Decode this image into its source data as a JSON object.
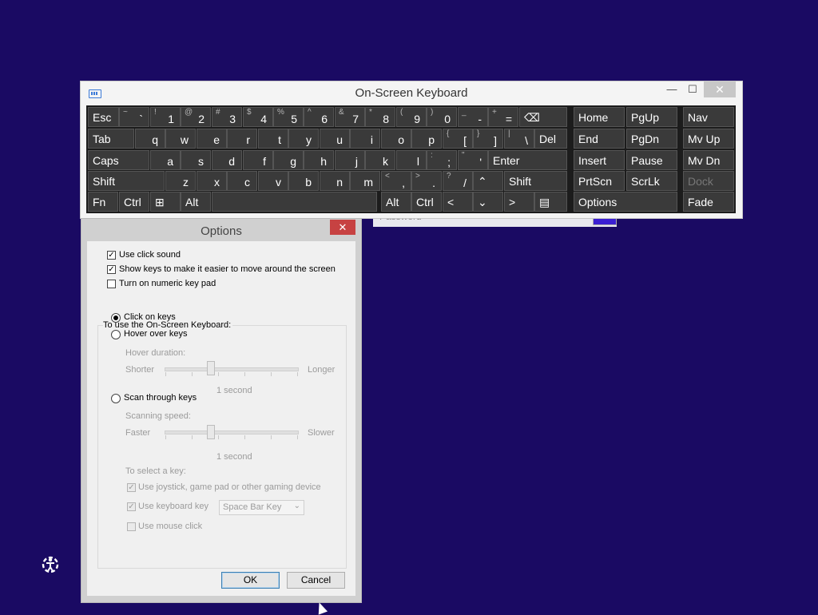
{
  "login": {
    "password_placeholder": "Password"
  },
  "osk": {
    "title": "On-Screen Keyboard",
    "minimize": "—",
    "maximize": "☐",
    "close": "✕",
    "keys": [
      {
        "id": "esc",
        "label": "Esc"
      },
      {
        "id": "tilde",
        "shift": "~",
        "label": "`"
      },
      {
        "id": "k1",
        "shift": "!",
        "label": "1"
      },
      {
        "id": "k2",
        "shift": "@",
        "label": "2"
      },
      {
        "id": "k3",
        "shift": "#",
        "label": "3"
      },
      {
        "id": "k4",
        "shift": "$",
        "label": "4"
      },
      {
        "id": "k5",
        "shift": "%",
        "label": "5"
      },
      {
        "id": "k6",
        "shift": "^",
        "label": "6"
      },
      {
        "id": "k7",
        "shift": "&",
        "label": "7"
      },
      {
        "id": "k8",
        "shift": "*",
        "label": "8"
      },
      {
        "id": "k9",
        "shift": "(",
        "label": "9"
      },
      {
        "id": "k0",
        "shift": ")",
        "label": "0"
      },
      {
        "id": "minus",
        "shift": "_",
        "label": "-"
      },
      {
        "id": "equals",
        "shift": "+",
        "label": "="
      },
      {
        "id": "backspace",
        "label": "⌫"
      },
      {
        "id": "home",
        "label": "Home"
      },
      {
        "id": "pgup",
        "label": "PgUp"
      },
      {
        "id": "nav",
        "label": "Nav"
      },
      {
        "id": "tab",
        "label": "Tab"
      },
      {
        "id": "q",
        "label": "q"
      },
      {
        "id": "w",
        "label": "w"
      },
      {
        "id": "e",
        "label": "e"
      },
      {
        "id": "r",
        "label": "r"
      },
      {
        "id": "t",
        "label": "t"
      },
      {
        "id": "y",
        "label": "y"
      },
      {
        "id": "u",
        "label": "u"
      },
      {
        "id": "i",
        "label": "i"
      },
      {
        "id": "o",
        "label": "o"
      },
      {
        "id": "p",
        "label": "p"
      },
      {
        "id": "lbracket",
        "shift": "{",
        "label": "["
      },
      {
        "id": "rbracket",
        "shift": "}",
        "label": "]"
      },
      {
        "id": "backslash",
        "shift": "|",
        "label": "\\"
      },
      {
        "id": "del",
        "label": "Del"
      },
      {
        "id": "end",
        "label": "End"
      },
      {
        "id": "pgdn",
        "label": "PgDn"
      },
      {
        "id": "mvup",
        "label": "Mv Up"
      },
      {
        "id": "caps",
        "label": "Caps"
      },
      {
        "id": "a",
        "label": "a"
      },
      {
        "id": "s",
        "label": "s"
      },
      {
        "id": "d",
        "label": "d"
      },
      {
        "id": "f",
        "label": "f"
      },
      {
        "id": "g",
        "label": "g"
      },
      {
        "id": "h",
        "label": "h"
      },
      {
        "id": "j",
        "label": "j"
      },
      {
        "id": "k",
        "label": "k"
      },
      {
        "id": "l",
        "label": "l"
      },
      {
        "id": "semicolon",
        "shift": ":",
        "label": ";"
      },
      {
        "id": "quote",
        "shift": "\"",
        "label": "'"
      },
      {
        "id": "enter",
        "label": "Enter"
      },
      {
        "id": "insert",
        "label": "Insert"
      },
      {
        "id": "pause",
        "label": "Pause"
      },
      {
        "id": "mvdn",
        "label": "Mv Dn"
      },
      {
        "id": "lshift",
        "label": "Shift"
      },
      {
        "id": "z",
        "label": "z"
      },
      {
        "id": "x",
        "label": "x"
      },
      {
        "id": "c",
        "label": "c"
      },
      {
        "id": "v",
        "label": "v"
      },
      {
        "id": "b",
        "label": "b"
      },
      {
        "id": "n",
        "label": "n"
      },
      {
        "id": "m",
        "label": "m"
      },
      {
        "id": "comma",
        "shift": "<",
        "label": ","
      },
      {
        "id": "period",
        "shift": ">",
        "label": "."
      },
      {
        "id": "slash",
        "shift": "?",
        "label": "/"
      },
      {
        "id": "up",
        "label": "⌃"
      },
      {
        "id": "rshift",
        "label": "Shift"
      },
      {
        "id": "prtscn",
        "label": "PrtScn"
      },
      {
        "id": "scrlk",
        "label": "ScrLk"
      },
      {
        "id": "dock",
        "label": "Dock"
      },
      {
        "id": "fn",
        "label": "Fn"
      },
      {
        "id": "lctrl",
        "label": "Ctrl"
      },
      {
        "id": "win",
        "label": "⊞"
      },
      {
        "id": "lalt",
        "label": "Alt"
      },
      {
        "id": "space",
        "label": ""
      },
      {
        "id": "ralt",
        "label": "Alt"
      },
      {
        "id": "rctrl",
        "label": "Ctrl"
      },
      {
        "id": "left",
        "label": "<"
      },
      {
        "id": "down",
        "label": "⌄"
      },
      {
        "id": "right",
        "label": ">"
      },
      {
        "id": "menu",
        "label": "▤"
      },
      {
        "id": "options",
        "label": "Options"
      },
      {
        "id": "fade",
        "label": "Fade"
      }
    ]
  },
  "options": {
    "title": "Options",
    "close": "✕",
    "use_click_sound": {
      "label": "Use click sound",
      "checked": true
    },
    "show_keys": {
      "label": "Show keys to make it easier to move around the screen",
      "checked": true
    },
    "numeric_pad": {
      "label": "Turn on numeric key pad",
      "checked": false
    },
    "group_label": "To use the On-Screen Keyboard:",
    "click_on_keys": "Click on keys",
    "hover_over_keys": "Hover over keys",
    "hover_duration": "Hover duration:",
    "shorter": "Shorter",
    "longer": "Longer",
    "hover_value": "1 second",
    "scan_through_keys": "Scan through keys",
    "scanning_speed": "Scanning speed:",
    "faster": "Faster",
    "slower": "Slower",
    "scan_value": "1 second",
    "to_select": "To select a key:",
    "use_joystick": {
      "label": "Use joystick, game pad or other gaming device",
      "checked": true
    },
    "use_keyboard_key": {
      "label": "Use keyboard key",
      "checked": true
    },
    "keyboard_key_value": "Space Bar Key",
    "use_mouse_click": {
      "label": "Use mouse click",
      "checked": false
    },
    "ok": "OK",
    "cancel": "Cancel"
  }
}
